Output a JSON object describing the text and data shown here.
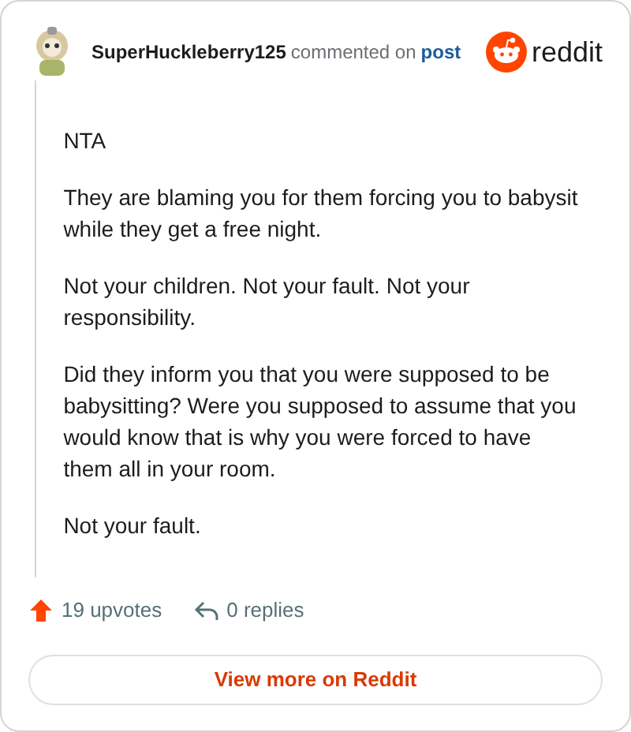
{
  "header": {
    "author": "SuperHuckleberry125",
    "action": "commented on",
    "link": "post",
    "brand": "reddit"
  },
  "body": [
    "NTA",
    "They are blaming you for them forcing you to babysit while they get a free night.",
    "Not your children. Not your fault. Not your responsibility.",
    "Did they inform you that you were supposed to be babysitting? Were you supposed to assume that you would know that is why you were forced to have them all in your room.",
    "Not your fault."
  ],
  "footer": {
    "upvotes": "19 upvotes",
    "replies": "0 replies"
  },
  "button": "View more on Reddit"
}
